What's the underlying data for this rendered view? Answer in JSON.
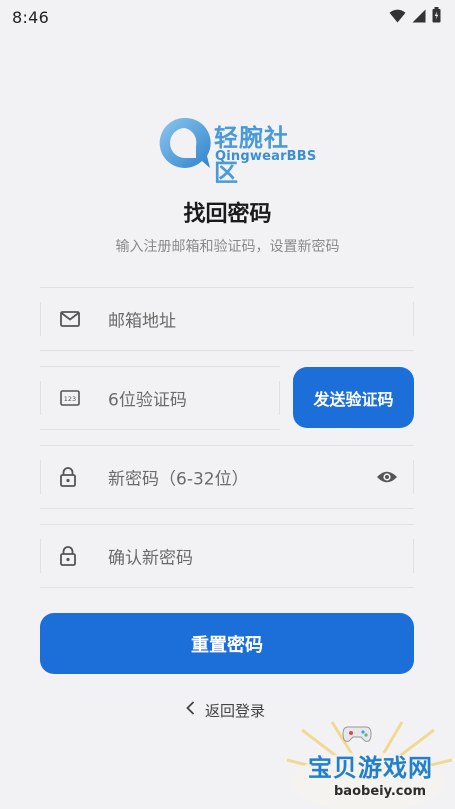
{
  "status_bar": {
    "time": "8:46"
  },
  "logo": {
    "title": "轻腕社区",
    "subtitle": "QingwearBBS"
  },
  "page": {
    "title": "找回密码",
    "subtitle": "输入注册邮箱和验证码，设置新密码"
  },
  "form": {
    "email": {
      "placeholder": "邮箱地址",
      "icon": "mail-icon"
    },
    "code": {
      "placeholder": "6位验证码",
      "icon": "code-123-icon"
    },
    "send_code_label": "发送验证码",
    "new_password": {
      "placeholder": "新密码（6-32位）",
      "icon": "lock-icon",
      "toggle_icon": "eye-icon"
    },
    "confirm_password": {
      "placeholder": "确认新密码",
      "icon": "lock-icon"
    },
    "reset_label": "重置密码",
    "back_label": "返回登录"
  },
  "watermark": {
    "text": "宝贝游戏网",
    "url": "baobeiy.com"
  },
  "colors": {
    "primary": "#1c6ed9",
    "background": "#f2f2f5",
    "logo": "#4a9ad8"
  }
}
